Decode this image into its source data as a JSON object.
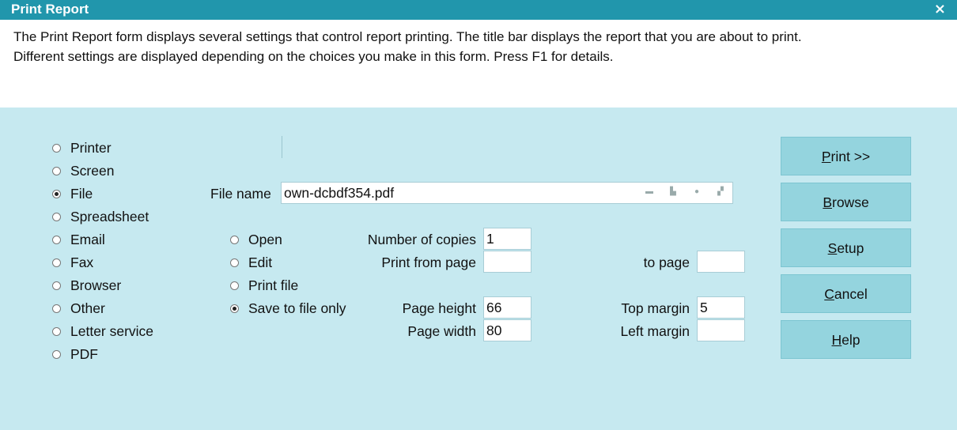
{
  "window": {
    "title": "Print Report",
    "close": "×"
  },
  "description": [
    "The Print Report form displays several settings that control report printing. The title bar displays the report that you are about to print.",
    "Different settings are displayed depending on the choices you make in this form. Press F1 for details."
  ],
  "destinations": [
    {
      "label": "Printer",
      "checked": false
    },
    {
      "label": "Screen",
      "checked": false
    },
    {
      "label": "File",
      "checked": true
    },
    {
      "label": "Spreadsheet",
      "checked": false
    },
    {
      "label": "Email",
      "checked": false
    },
    {
      "label": "Fax",
      "checked": false
    },
    {
      "label": "Browser",
      "checked": false
    },
    {
      "label": "Other",
      "checked": false
    },
    {
      "label": "Letter service",
      "checked": false
    },
    {
      "label": "PDF",
      "checked": false
    }
  ],
  "file": {
    "label": "File name",
    "value": "own-dcbdf354.pdf",
    "icons": [
      "folder-icon",
      "printer-icon",
      "clear-icon",
      "lock-search-icon"
    ]
  },
  "file_actions": [
    {
      "label": "Open",
      "checked": false
    },
    {
      "label": "Edit",
      "checked": false
    },
    {
      "label": "Print file",
      "checked": false
    },
    {
      "label": "Save to file only",
      "checked": true
    }
  ],
  "fields": {
    "copies_label": "Number of copies",
    "copies_value": "1",
    "from_page_label": "Print from page",
    "from_page_value": "",
    "to_page_label": "to page",
    "to_page_value": "",
    "page_height_label": "Page height",
    "page_height_value": "66",
    "page_width_label": "Page width",
    "page_width_value": "80",
    "top_margin_label": "Top margin",
    "top_margin_value": "5",
    "left_margin_label": "Left margin",
    "left_margin_value": ""
  },
  "buttons": {
    "print": {
      "pre": "",
      "ul": "P",
      "post": "rint >>"
    },
    "browse": {
      "pre": "",
      "ul": "B",
      "post": "rowse"
    },
    "setup": {
      "pre": "",
      "ul": "S",
      "post": "etup"
    },
    "cancel": {
      "pre": "",
      "ul": "C",
      "post": "ancel"
    },
    "help": {
      "pre": "",
      "ul": "H",
      "post": "elp"
    }
  },
  "colors": {
    "titlebar": "#2196ac",
    "panel": "#c6e9f0",
    "button": "#94d4de"
  }
}
